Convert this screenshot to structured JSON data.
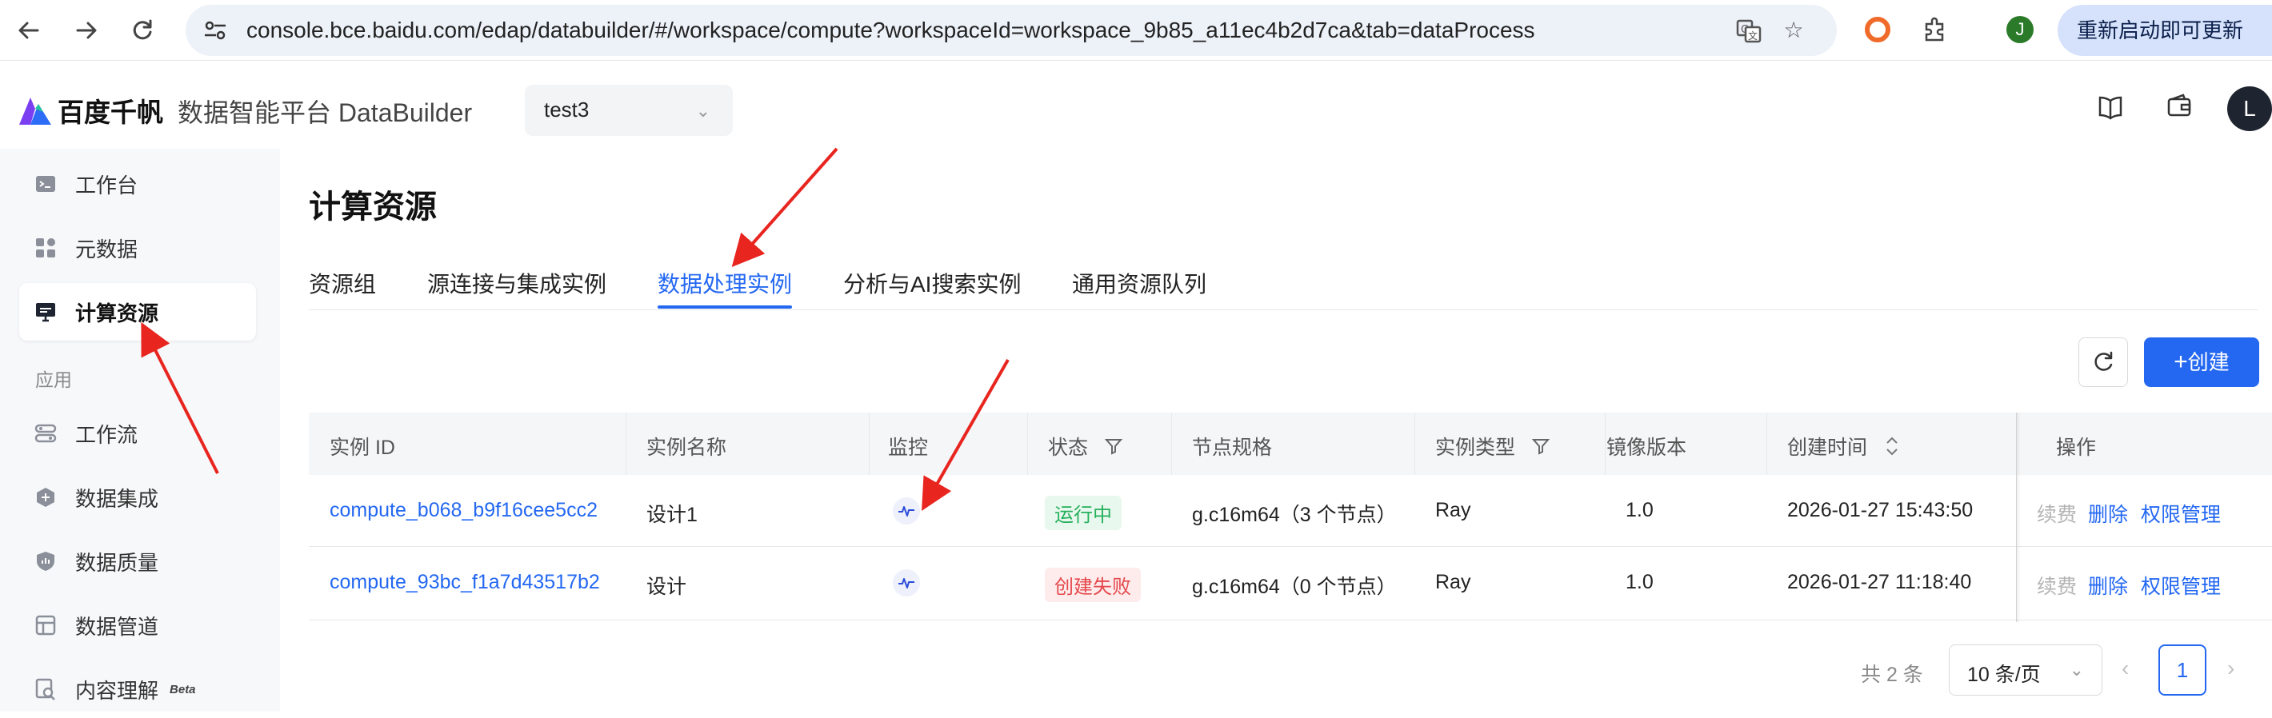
{
  "browser": {
    "url": "console.bce.baidu.com/edap/databuilder/#/workspace/compute?workspaceId=workspace_9b85_a11ec4b2d7ca&tab=dataProcess",
    "profile_initial": "J",
    "relaunch_label": "重新启动即可更新"
  },
  "app": {
    "logo_text": "百度千帆",
    "product_name": "数据智能平台 DataBuilder",
    "workspace": "test3",
    "user_initial": "L"
  },
  "sidebar": {
    "items": [
      {
        "label": "工作台",
        "icon": "terminal-icon"
      },
      {
        "label": "元数据",
        "icon": "grid-icon"
      },
      {
        "label": "计算资源",
        "icon": "monitor-icon"
      }
    ],
    "group_label": "应用",
    "app_items": [
      {
        "label": "工作流",
        "icon": "workflow-icon"
      },
      {
        "label": "数据集成",
        "icon": "integration-icon"
      },
      {
        "label": "数据质量",
        "icon": "shield-icon"
      },
      {
        "label": "数据管道",
        "icon": "pipeline-icon"
      },
      {
        "label": "内容理解",
        "icon": "content-icon",
        "badge": "Beta"
      }
    ]
  },
  "page": {
    "title": "计算资源",
    "tabs": [
      "资源组",
      "源连接与集成实例",
      "数据处理实例",
      "分析与AI搜索实例",
      "通用资源队列"
    ],
    "active_tab": "数据处理实例",
    "create_label": "创建"
  },
  "table": {
    "columns": [
      "实例 ID",
      "实例名称",
      "监控",
      "状态",
      "节点规格",
      "实例类型",
      "镜像版本",
      "创建时间",
      "操作"
    ],
    "rows": [
      {
        "id": "compute_b068_b9f16cee5cc2",
        "name": "设计1",
        "status": "运行中",
        "spec": "g.c16m64（3 个节点）",
        "type": "Ray",
        "image": "1.0",
        "created": "2026-01-27 15:43:50",
        "ops": [
          "续费",
          "删除",
          "权限管理"
        ]
      },
      {
        "id": "compute_93bc_f1a7d43517b2",
        "name": "设计",
        "status": "创建失败",
        "spec": "g.c16m64（0 个节点）",
        "type": "Ray",
        "image": "1.0",
        "created": "2026-01-27 11:18:40",
        "ops": [
          "续费",
          "删除",
          "权限管理"
        ]
      }
    ]
  },
  "pagination": {
    "total": "共 2 条",
    "page_size": "10 条/页",
    "current_page": "1"
  },
  "colors": {
    "accent": "#2468f2",
    "running": "#25b05c",
    "failed": "#e5484d",
    "annotation_arrow": "#e8251f"
  }
}
